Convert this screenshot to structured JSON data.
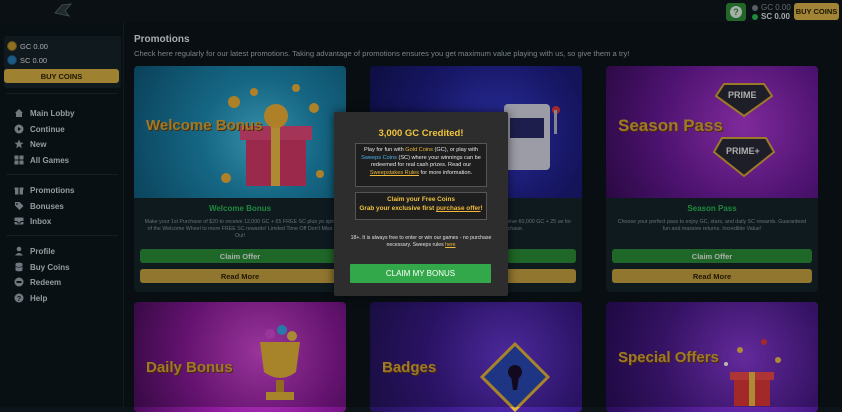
{
  "header": {
    "wallet_gc": "GC 0.00",
    "wallet_sc": "SC 0.00",
    "buy_label": "BUY COINS",
    "help_icon": "question-icon"
  },
  "sidebar": {
    "gc_balance": "GC 0.00",
    "sc_balance": "SC 0.00",
    "buy_label": "BUY COINS",
    "nav": [
      {
        "label": "Main Lobby",
        "icon": "home-icon"
      },
      {
        "label": "Continue",
        "icon": "play-icon"
      },
      {
        "label": "New",
        "icon": "star-icon"
      },
      {
        "label": "All Games",
        "icon": "grid-icon"
      },
      {
        "label": "Promotions",
        "icon": "gift-icon"
      },
      {
        "label": "Bonuses",
        "icon": "tag-icon"
      },
      {
        "label": "Inbox",
        "icon": "inbox-icon"
      },
      {
        "label": "Profile",
        "icon": "user-icon"
      },
      {
        "label": "Buy Coins",
        "icon": "coins-icon"
      },
      {
        "label": "Redeem",
        "icon": "redeem-icon"
      },
      {
        "label": "Help",
        "icon": "help-icon"
      }
    ]
  },
  "main": {
    "title": "Promotions",
    "subtitle": "Check here regularly for our latest promotions. Taking advantage of promotions ensures you get maximum value playing with us, so give them a try!",
    "cards": [
      {
        "banner": "Welcome Bonus",
        "title": "Welcome Bonus",
        "desc": "Make your 1st Purchase of $20 to receive 12,000 GC + 65 FREE SC plus yo spin of the Welcome Wheel to more FREE SC rewards! Limited Time Off Don't Miss Out!",
        "claim": "Claim Offer",
        "more": "Read More"
      },
      {
        "banner": "",
        "title": "",
        "desc": "receive 60,000 GC + 25 ue for purchase.",
        "claim": "",
        "more": ""
      },
      {
        "banner": "Season Pass",
        "title": "Season Pass",
        "desc": "Choose your perfect pass to enjoy GC, stars, and daily SC rewards. Guaranteed fun and massive returns. Incredible Value!",
        "claim": "Claim Offer",
        "more": "Read More",
        "badge1": "PRIME",
        "badge2": "PRIME+"
      },
      {
        "banner": "Daily Bonus"
      },
      {
        "banner": "Badges"
      },
      {
        "banner": "Special Offers"
      }
    ]
  },
  "modal": {
    "title": "3,000 GC Credited!",
    "p1_a": "Play for fun with ",
    "p1_gold": "Gold Coins",
    "p1_b": " (GC), or play with ",
    "p1_sweeps": "Sweeps Coins",
    "p1_c": " (SC) where your winnings can be redeemed for real cash prizes. Read our ",
    "p1_link": "Sweepstakes Rules",
    "p1_d": " for more information.",
    "claim_line1": "Claim your Free Coins",
    "claim_line2_a": "Grab your exclusive first ",
    "claim_line2_link": "purchase offer",
    "claim_line2_b": "!",
    "note_a": "18+. It is always free to enter or win our games - no purchase necessary. Sweeps rules ",
    "note_link": "here",
    "button": "CLAIM MY BONUS"
  },
  "colors": {
    "accent_green": "#33a84a",
    "accent_gold": "#dcb545",
    "modal_title": "#f2c53d"
  }
}
